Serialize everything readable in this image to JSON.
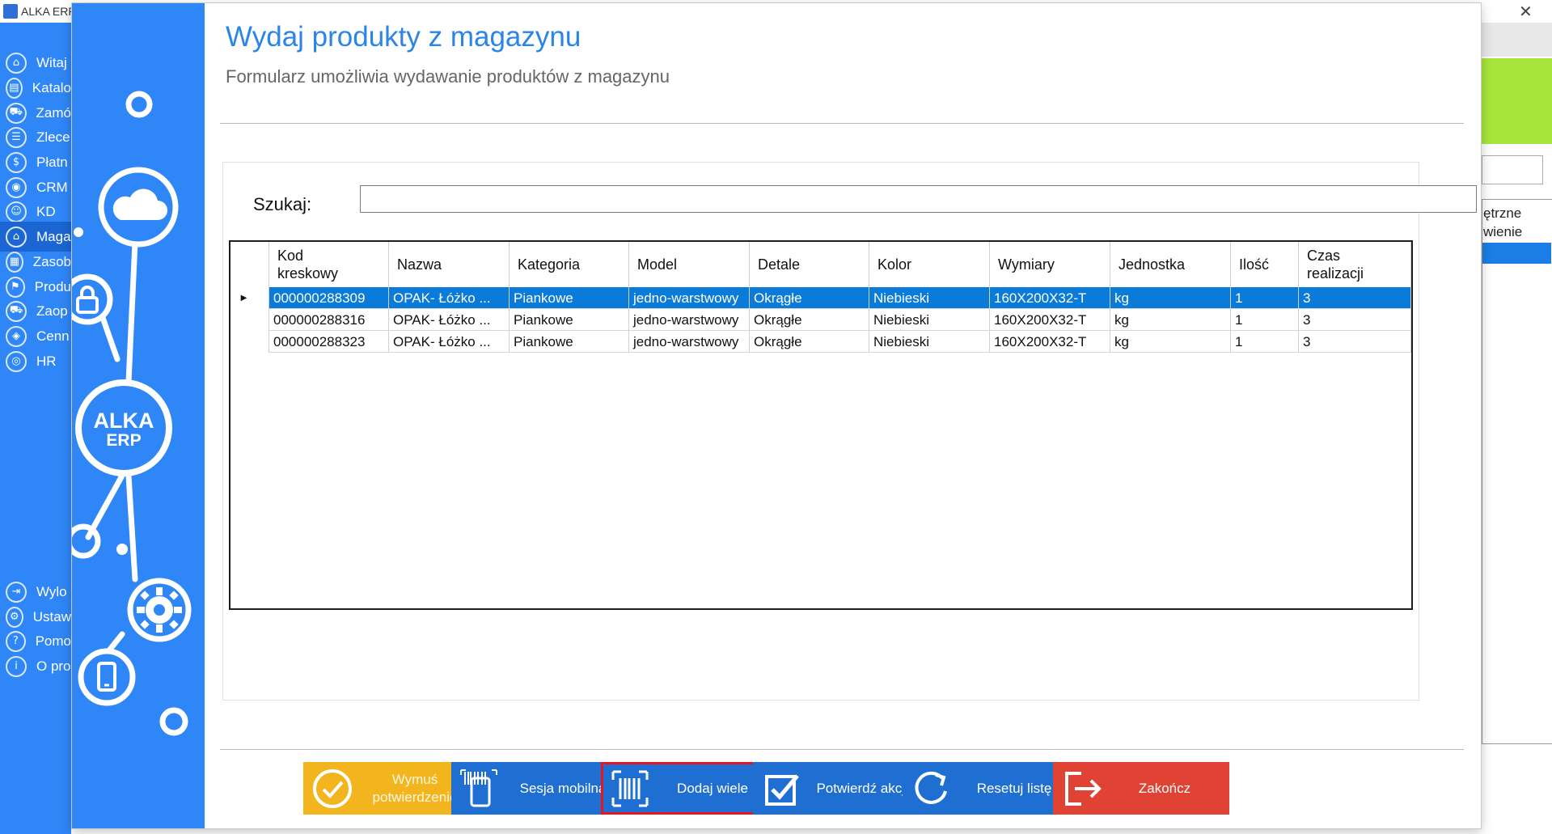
{
  "app": {
    "window_title": "ALKA ERP",
    "close_glyph": "✕"
  },
  "sidebar": {
    "items": [
      {
        "label": "Witaj",
        "icon": "home-icon",
        "glyph": "⌂",
        "active": false
      },
      {
        "label": "Katalo",
        "icon": "catalog-icon",
        "glyph": "▤",
        "active": false
      },
      {
        "label": "Zamó",
        "icon": "cart-icon",
        "glyph": "⛟",
        "active": false
      },
      {
        "label": "Zlece",
        "icon": "list-icon",
        "glyph": "☰",
        "active": false
      },
      {
        "label": "Płatn",
        "icon": "dollar-icon",
        "glyph": "$",
        "active": false
      },
      {
        "label": "CRM",
        "icon": "crm-icon",
        "glyph": "◉",
        "active": false
      },
      {
        "label": "KD",
        "icon": "person-icon",
        "glyph": "☺",
        "active": false
      },
      {
        "label": "Maga",
        "icon": "warehouse-icon",
        "glyph": "⌂",
        "active": true
      },
      {
        "label": "Zasob",
        "icon": "resources-icon",
        "glyph": "▦",
        "active": false
      },
      {
        "label": "Produ",
        "icon": "product-icon",
        "glyph": "⚑",
        "active": false
      },
      {
        "label": "Zaop",
        "icon": "truck-icon",
        "glyph": "⛟",
        "active": false
      },
      {
        "label": "Cenn",
        "icon": "tag-icon",
        "glyph": "◈",
        "active": false
      },
      {
        "label": "HR",
        "icon": "hr-icon",
        "glyph": "◎",
        "active": false
      }
    ],
    "bottom_items": [
      {
        "label": "Wylo",
        "icon": "logout-icon",
        "glyph": "⇥"
      },
      {
        "label": "Ustaw",
        "icon": "settings-icon",
        "glyph": "⚙"
      },
      {
        "label": "Pomo",
        "icon": "help-icon",
        "glyph": "?"
      },
      {
        "label": "O pro",
        "icon": "info-icon",
        "glyph": "i"
      }
    ]
  },
  "background_panel": {
    "text_line1": "ętrzne",
    "text_line2": "wienie"
  },
  "modal": {
    "title": "Wydaj produkty z magazynu",
    "subtitle": "Formularz umożliwia wydawanie produktów z magazynu",
    "logo_line1": "ALKA",
    "logo_line2": "ERP",
    "search": {
      "label": "Szukaj:",
      "value": "",
      "placeholder": ""
    },
    "grid": {
      "columns": [
        "Kod kreskowy",
        "Nazwa",
        "Kategoria",
        "Model",
        "Detale",
        "Kolor",
        "Wymiary",
        "Jednostka",
        "Ilość",
        "Czas realizacji"
      ],
      "rows": [
        {
          "selected": true,
          "cells": [
            "000000288309",
            "OPAK- Łóżko ...",
            "Piankowe",
            "jedno-warstwowy",
            "Okrągłe",
            "Niebieski",
            "160X200X32-T",
            "kg",
            "1",
            "3"
          ]
        },
        {
          "selected": false,
          "cells": [
            "000000288316",
            "OPAK- Łóżko ...",
            "Piankowe",
            "jedno-warstwowy",
            "Okrągłe",
            "Niebieski",
            "160X200X32-T",
            "kg",
            "1",
            "3"
          ]
        },
        {
          "selected": false,
          "cells": [
            "000000288323",
            "OPAK- Łóżko ...",
            "Piankowe",
            "jedno-warstwowy",
            "Okrągłe",
            "Niebieski",
            "160X200X32-T",
            "kg",
            "1",
            "3"
          ]
        }
      ],
      "current_row_marker": "▶"
    },
    "buttons": [
      {
        "id": "force",
        "label": "Wymuś potwierdzenie",
        "icon": "check-circle-icon",
        "color": "#f2b51e",
        "highlighted": false
      },
      {
        "id": "mobile",
        "label": "Sesja mobilna",
        "icon": "mobile-barcode-icon",
        "color": "#1f6fd2",
        "highlighted": false
      },
      {
        "id": "addmany",
        "label": "Dodaj wiele",
        "icon": "barcode-scan-icon",
        "color": "#1f6fd2",
        "highlighted": true
      },
      {
        "id": "confirm",
        "label": "Potwierdź akcję",
        "icon": "checkbox-icon",
        "color": "#1f6fd2",
        "highlighted": false
      },
      {
        "id": "reset",
        "label": "Resetuj listę",
        "icon": "refresh-icon",
        "color": "#1f6fd2",
        "highlighted": false
      },
      {
        "id": "finish",
        "label": "Zakończ",
        "icon": "exit-icon",
        "color": "#e04334",
        "highlighted": false
      }
    ]
  },
  "colors": {
    "accent_blue": "#2f86f6",
    "title_blue": "#2b85e8",
    "selection_blue": "#0a7bd8",
    "button_blue": "#1f6fd2",
    "button_yellow": "#f2b51e",
    "button_red": "#e04334",
    "highlight_red": "#e8141e",
    "green_panel": "#a8e63b"
  }
}
